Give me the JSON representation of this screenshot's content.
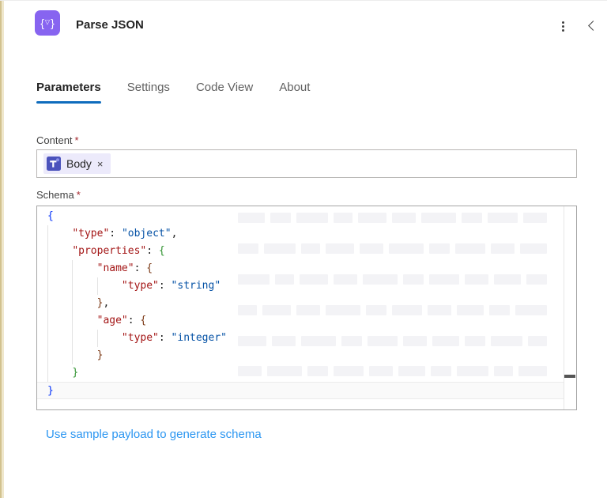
{
  "header": {
    "title": "Parse JSON",
    "icon_glyph": {
      "left": "{",
      "mid": "▽",
      "right": "}"
    }
  },
  "tabs": [
    {
      "label": "Parameters",
      "active": true
    },
    {
      "label": "Settings",
      "active": false
    },
    {
      "label": "Code View",
      "active": false
    },
    {
      "label": "About",
      "active": false
    }
  ],
  "fields": {
    "content": {
      "label": "Content",
      "required_mark": "*",
      "token": {
        "icon": "teams-icon",
        "label": "Body",
        "remove_glyph": "×"
      }
    },
    "schema": {
      "label": "Schema",
      "required_mark": "*",
      "code_lines": [
        {
          "indent": 0,
          "segments": [
            {
              "text": "{",
              "type": "b1"
            }
          ]
        },
        {
          "indent": 4,
          "segments": [
            {
              "text": "\"type\"",
              "type": "key"
            },
            {
              "text": ": ",
              "type": "p"
            },
            {
              "text": "\"object\"",
              "type": "val"
            },
            {
              "text": ",",
              "type": "p"
            }
          ]
        },
        {
          "indent": 4,
          "segments": [
            {
              "text": "\"properties\"",
              "type": "key"
            },
            {
              "text": ": ",
              "type": "p"
            },
            {
              "text": "{",
              "type": "b2"
            }
          ]
        },
        {
          "indent": 8,
          "segments": [
            {
              "text": "\"name\"",
              "type": "key"
            },
            {
              "text": ": ",
              "type": "p"
            },
            {
              "text": "{",
              "type": "b3"
            }
          ]
        },
        {
          "indent": 12,
          "segments": [
            {
              "text": "\"type\"",
              "type": "key"
            },
            {
              "text": ": ",
              "type": "p"
            },
            {
              "text": "\"string\"",
              "type": "val"
            }
          ]
        },
        {
          "indent": 8,
          "segments": [
            {
              "text": "}",
              "type": "b3"
            },
            {
              "text": ",",
              "type": "p"
            }
          ]
        },
        {
          "indent": 8,
          "segments": [
            {
              "text": "\"age\"",
              "type": "key"
            },
            {
              "text": ": ",
              "type": "p"
            },
            {
              "text": "{",
              "type": "b3"
            }
          ]
        },
        {
          "indent": 12,
          "segments": [
            {
              "text": "\"type\"",
              "type": "key"
            },
            {
              "text": ": ",
              "type": "p"
            },
            {
              "text": "\"integer\"",
              "type": "val"
            }
          ]
        },
        {
          "indent": 8,
          "segments": [
            {
              "text": "}",
              "type": "b3"
            }
          ]
        },
        {
          "indent": 4,
          "segments": [
            {
              "text": "}",
              "type": "b2"
            }
          ]
        },
        {
          "indent": 0,
          "segments": [
            {
              "text": "}",
              "type": "b1"
            }
          ],
          "current": true
        }
      ]
    }
  },
  "footer": {
    "link_label": "Use sample payload to generate schema"
  },
  "colors": {
    "accent": "#0f6cbd",
    "link": "#2b96f1",
    "icon_purple": "#8764f0",
    "token_key": "#a31515",
    "token_value": "#0451a5",
    "bracket1": "#0431fa",
    "bracket2": "#319331",
    "bracket3": "#7b3814",
    "teams_icon_bg": "#4b53bc",
    "required_red": "#a4262c"
  }
}
